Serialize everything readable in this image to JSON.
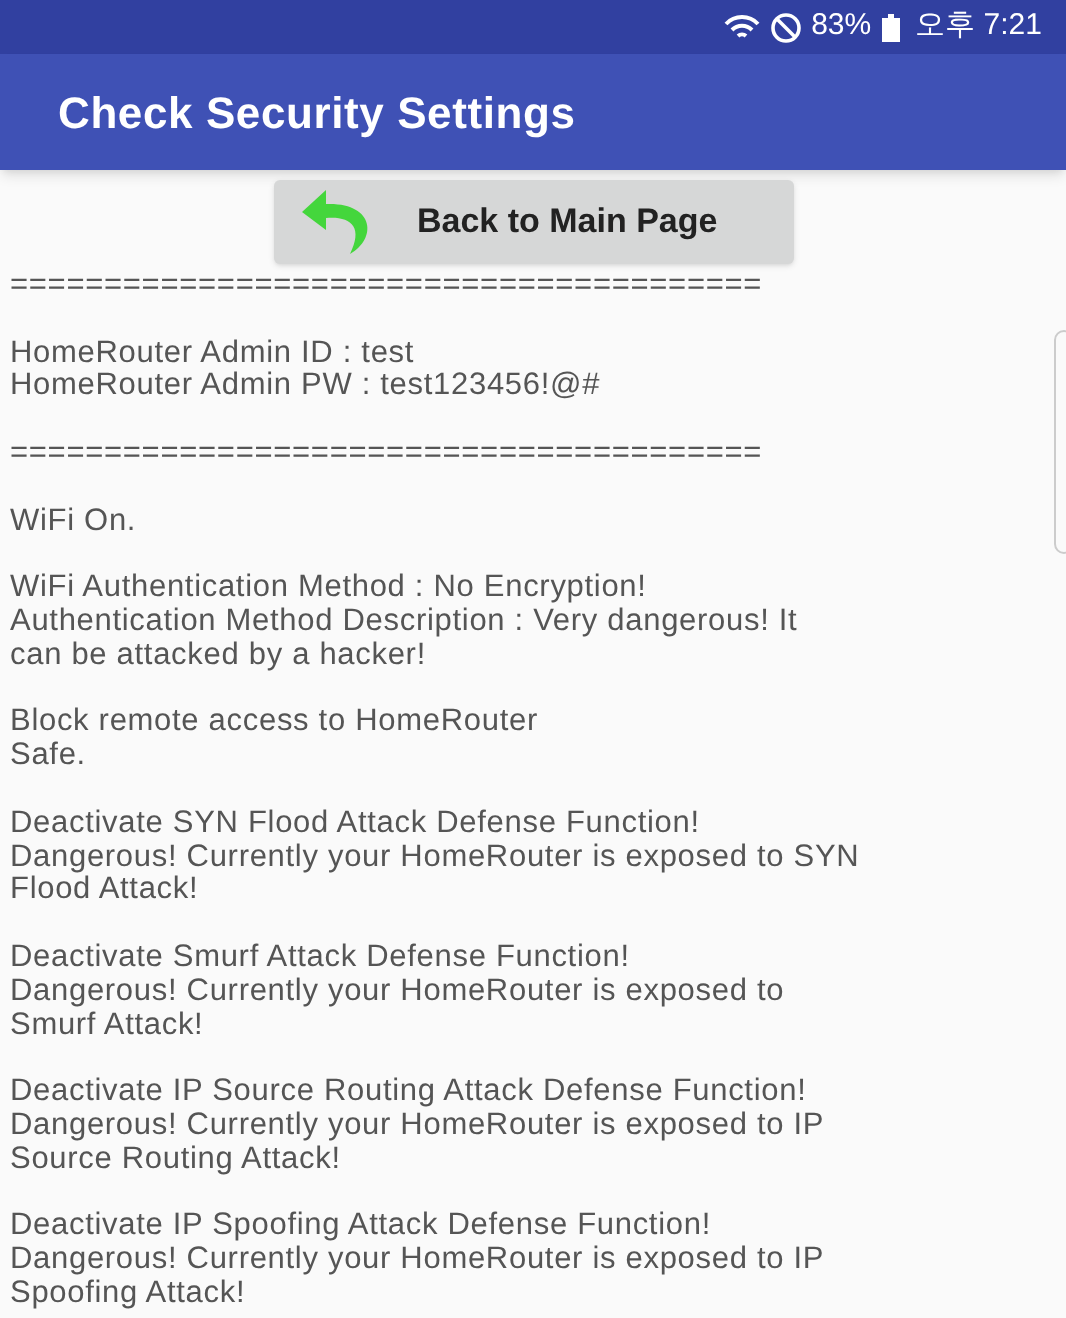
{
  "status_bar": {
    "battery": "83%",
    "time": "오후 7:21"
  },
  "app_bar": {
    "title": "Check Security Settings"
  },
  "back_button": {
    "label": "Back to Main Page"
  },
  "report": [
    [
      "========================================"
    ],
    [
      "HomeRouter Admin ID : test",
      "HomeRouter Admin PW : test123456!@#"
    ],
    [
      "========================================"
    ],
    [
      "WiFi On."
    ],
    [
      "WiFi Authentication Method : No Encryption!",
      "Authentication Method Description : Very dangerous! It",
      "can be attacked by a hacker!"
    ],
    [
      "Block remote access to HomeRouter",
      "Safe."
    ],
    [
      "Deactivate SYN Flood Attack Defense Function!",
      "Dangerous! Currently your HomeRouter is exposed to SYN",
      "Flood Attack!"
    ],
    [
      "Deactivate Smurf Attack Defense Function!",
      "Dangerous! Currently your HomeRouter is exposed to",
      "Smurf Attack!"
    ],
    [
      "Deactivate IP Source Routing Attack Defense Function!",
      "Dangerous! Currently your HomeRouter is exposed to IP",
      "Source Routing Attack!"
    ],
    [
      "Deactivate IP Spoofing Attack Defense Function!",
      "Dangerous! Currently your HomeRouter is exposed to IP",
      "Spoofing Attack!"
    ]
  ]
}
